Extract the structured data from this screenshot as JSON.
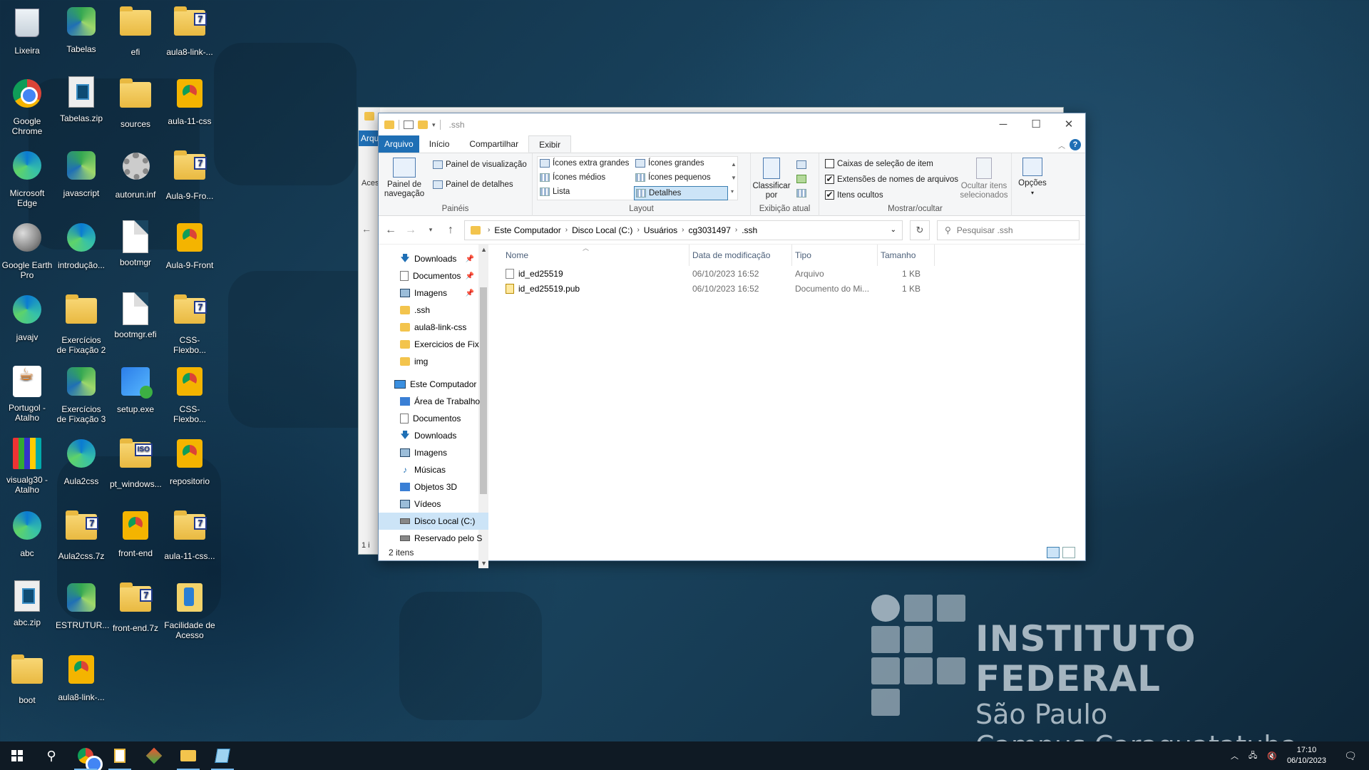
{
  "desktop": {
    "icons": [
      {
        "label": "Lixeira",
        "icon": "recycle-bin-icon"
      },
      {
        "label": "Tabelas",
        "icon": "vscode-file-icon"
      },
      {
        "label": "efi",
        "icon": "folder-icon"
      },
      {
        "label": "aula8-link-...",
        "icon": "7z-archive-icon"
      },
      {
        "label": "Google Chrome",
        "icon": "chrome-icon"
      },
      {
        "label": "Tabelas.zip",
        "icon": "zip-icon"
      },
      {
        "label": "sources",
        "icon": "folder-icon"
      },
      {
        "label": "aula-11-css",
        "icon": "chrome-html-icon"
      },
      {
        "label": "Microsoft Edge",
        "icon": "edge-icon"
      },
      {
        "label": "javascript",
        "icon": "vscode-file-icon"
      },
      {
        "label": "autorun.inf",
        "icon": "gear-icon"
      },
      {
        "label": "Aula-9-Fro...",
        "icon": "7z-archive-icon"
      },
      {
        "label": "Google Earth Pro",
        "icon": "google-earth-icon"
      },
      {
        "label": "introdução...",
        "icon": "edge-icon"
      },
      {
        "label": "bootmgr",
        "icon": "file-icon"
      },
      {
        "label": "Aula-9-Front",
        "icon": "chrome-html-icon"
      },
      {
        "label": "javajv",
        "icon": "edge-icon"
      },
      {
        "label": "Exercícios de Fixação 2",
        "icon": "folder-icon"
      },
      {
        "label": "bootmgr.efi",
        "icon": "file-icon"
      },
      {
        "label": "CSS-Flexbo...",
        "icon": "7z-archive-icon"
      },
      {
        "label": "Portugol - Atalho",
        "icon": "java-icon"
      },
      {
        "label": "Exercícios de Fixação 3",
        "icon": "vscode-file-icon"
      },
      {
        "label": "setup.exe",
        "icon": "setup-icon"
      },
      {
        "label": "CSS-Flexbo...",
        "icon": "chrome-html-icon"
      },
      {
        "label": "visualg30 - Atalho",
        "icon": "visualg-icon"
      },
      {
        "label": "Aula2css",
        "icon": "edge-icon"
      },
      {
        "label": "pt_windows...",
        "icon": "iso-icon"
      },
      {
        "label": "repositorio",
        "icon": "chrome-html-icon"
      },
      {
        "label": "abc",
        "icon": "edge-icon"
      },
      {
        "label": "Aula2css.7z",
        "icon": "7z-archive-icon"
      },
      {
        "label": "front-end",
        "icon": "chrome-html-icon"
      },
      {
        "label": "aula-11-css...",
        "icon": "7z-archive-icon"
      },
      {
        "label": "abc.zip",
        "icon": "zip-icon"
      },
      {
        "label": "ESTRUTUR...",
        "icon": "vscode-file-icon"
      },
      {
        "label": "front-end.7z",
        "icon": "7z-archive-icon"
      },
      {
        "label": "Facilidade de Acesso",
        "icon": "accessibility-icon"
      },
      {
        "label": "boot",
        "icon": "folder-icon"
      },
      {
        "label": "aula8-link-...",
        "icon": "chrome-html-icon"
      }
    ],
    "logo": {
      "line1": "INSTITUTO FEDERAL",
      "line2": "São Paulo",
      "line3": "Campus Caraguatatuba"
    }
  },
  "back_window": {
    "tab_label": "Arqu",
    "label_acess": "Aces",
    "status": "1 i"
  },
  "explorer": {
    "title": ".ssh",
    "controls": {
      "minimize": "─",
      "maximize": "☐",
      "close": "✕"
    },
    "tabs": [
      "Arquivo",
      "Início",
      "Compartilhar",
      "Exibir"
    ],
    "active_tab": "Exibir",
    "ribbon": {
      "panes": {
        "nav_pane": "Painel de navegação",
        "preview_pane": "Painel de visualização",
        "details_pane": "Painel de detalhes",
        "group_label": "Painéis"
      },
      "layout": {
        "options": [
          "Ícones extra grandes",
          "Ícones grandes",
          "Ícones médios",
          "Ícones pequenos",
          "Lista",
          "Detalhes"
        ],
        "selected": "Detalhes",
        "group_label": "Layout"
      },
      "current_view": {
        "sort_by": "Classificar por",
        "group_label": "Exibição atual"
      },
      "show_hide": {
        "item_checkboxes": {
          "label": "Caixas de seleção de item",
          "checked": false
        },
        "file_extensions": {
          "label": "Extensões de nomes de arquivos",
          "checked": true
        },
        "hidden_items": {
          "label": "Itens ocultos",
          "checked": true
        },
        "hide_selected": "Ocultar itens selecionados",
        "group_label": "Mostrar/ocultar"
      },
      "options": "Opções"
    },
    "address": {
      "breadcrumbs": [
        "Este Computador",
        "Disco Local (C:)",
        "Usuários",
        "cg3031497",
        ".ssh"
      ],
      "search_placeholder": "Pesquisar .ssh"
    },
    "nav_pane": {
      "quick_access": [
        {
          "label": "Downloads",
          "icon": "download-icon",
          "pinned": true
        },
        {
          "label": "Documentos",
          "icon": "documents-icon",
          "pinned": true
        },
        {
          "label": "Imagens",
          "icon": "pictures-icon",
          "pinned": true
        },
        {
          "label": ".ssh",
          "icon": "folder-icon",
          "pinned": false
        },
        {
          "label": "aula8-link-css",
          "icon": "folder-icon",
          "pinned": false
        },
        {
          "label": "Exercicios de Fix",
          "icon": "folder-icon",
          "pinned": false
        },
        {
          "label": "img",
          "icon": "folder-icon",
          "pinned": false
        }
      ],
      "this_pc": "Este Computador",
      "this_pc_items": [
        {
          "label": "Área de Trabalho",
          "icon": "desktop-icon"
        },
        {
          "label": "Documentos",
          "icon": "documents-icon"
        },
        {
          "label": "Downloads",
          "icon": "download-icon"
        },
        {
          "label": "Imagens",
          "icon": "pictures-icon"
        },
        {
          "label": "Músicas",
          "icon": "music-icon"
        },
        {
          "label": "Objetos 3D",
          "icon": "3d-objects-icon"
        },
        {
          "label": "Vídeos",
          "icon": "videos-icon"
        },
        {
          "label": "Disco Local (C:)",
          "icon": "drive-icon",
          "selected": true
        },
        {
          "label": "Reservado pelo S",
          "icon": "drive-icon"
        }
      ]
    },
    "columns": [
      "Nome",
      "Data de modificação",
      "Tipo",
      "Tamanho"
    ],
    "files": [
      {
        "name": "id_ed25519",
        "modified": "06/10/2023 16:52",
        "type": "Arquivo",
        "size": "1 KB",
        "icon": "file-icon"
      },
      {
        "name": "id_ed25519.pub",
        "modified": "06/10/2023 16:52",
        "type": "Documento do Mi...",
        "size": "1 KB",
        "icon": "publisher-file-icon"
      }
    ],
    "status": "2 itens"
  },
  "taskbar": {
    "apps": [
      "start-icon",
      "search-icon",
      "chrome-icon",
      "file-icon",
      "git-icon",
      "file-explorer-icon",
      "notepad-icon"
    ],
    "time": "17:10",
    "date": "06/10/2023"
  }
}
